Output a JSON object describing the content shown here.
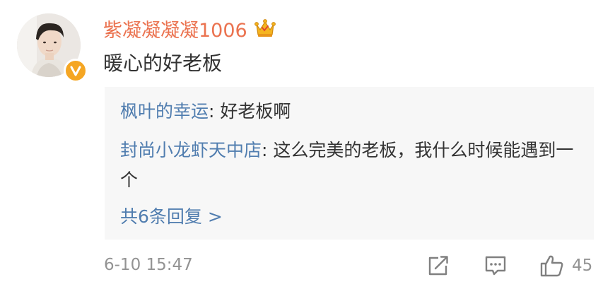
{
  "comment": {
    "username": "紫凝凝凝凝1006",
    "text": "暖心的好老板",
    "time": "6-10 15:47",
    "like_count": "45",
    "icons": {
      "verified": "verified-v-badge",
      "vip": "crown-icon",
      "share": "share-icon",
      "comment": "comment-icon",
      "like": "thumbs-up-icon"
    }
  },
  "replies": {
    "items": [
      {
        "author": "枫叶的幸运",
        "separator": ": ",
        "text": "好老板啊"
      },
      {
        "author": "封尚小龙虾天中店",
        "separator": ": ",
        "text": "这么完美的老板，我什么时候能遇到一个"
      }
    ],
    "more_label": "共6条回复 >"
  },
  "colors": {
    "username": "#eb7350",
    "link": "#507daf",
    "text": "#333333",
    "muted": "#939393",
    "reply_bg": "#f7f7f7",
    "badge": "#f5a623"
  }
}
